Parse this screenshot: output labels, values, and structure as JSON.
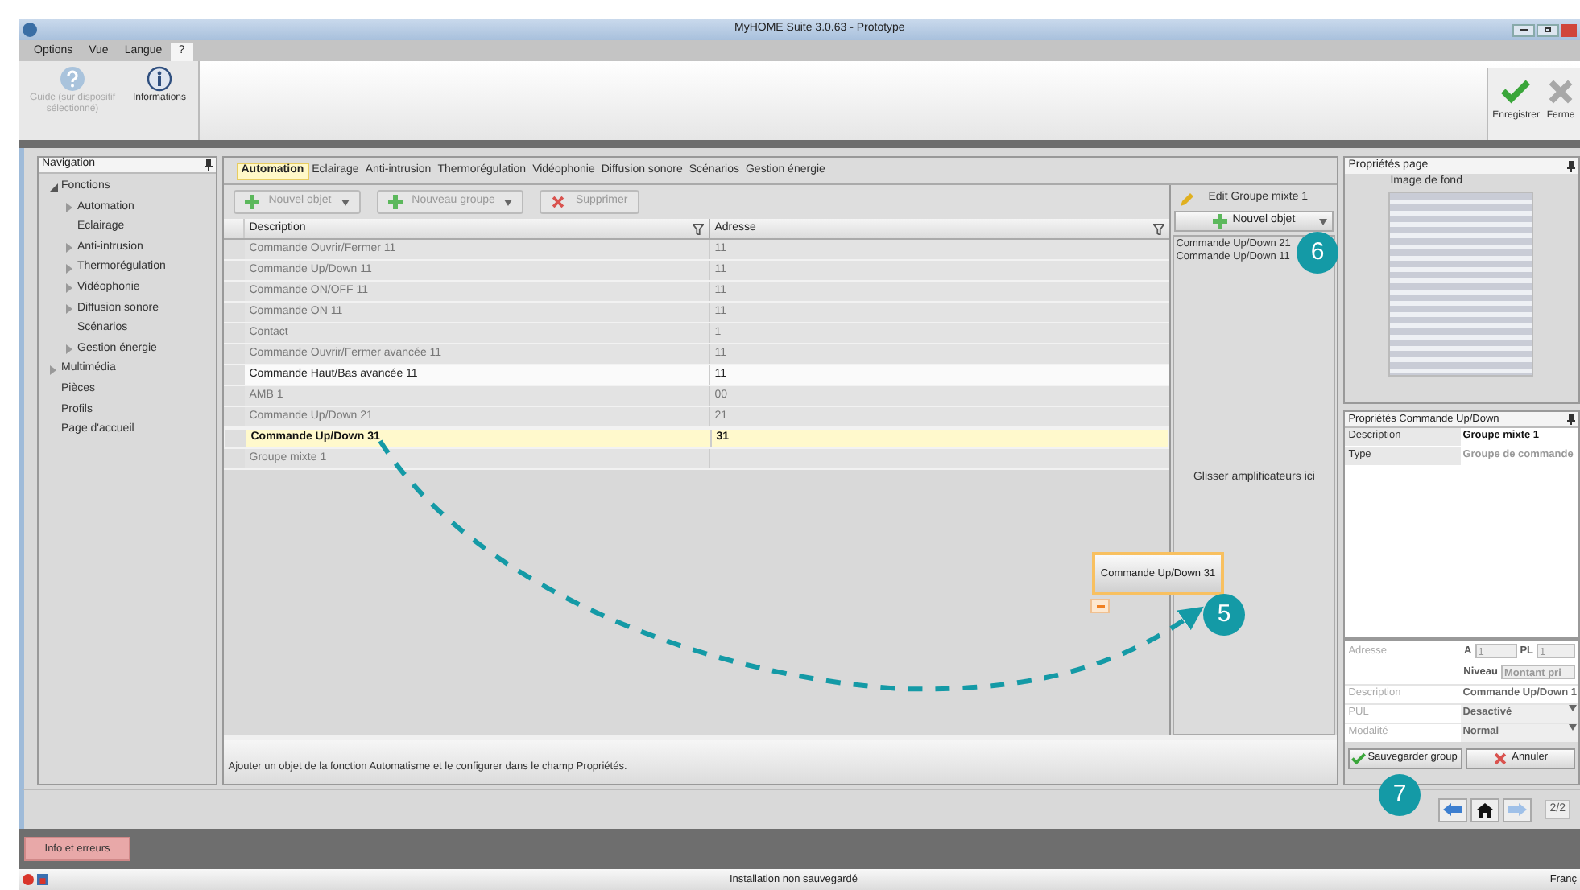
{
  "window": {
    "title": "MyHOME Suite 3.0.63 - Prototype"
  },
  "menu": [
    {
      "label": "Options",
      "selected": false
    },
    {
      "label": "Vue",
      "selected": false
    },
    {
      "label": "Langue",
      "selected": false
    },
    {
      "label": "?",
      "selected": true
    }
  ],
  "ribbon": {
    "left": [
      {
        "label": "Guide (sur dispositif sélectionné)",
        "disabled": true,
        "kind": "help"
      },
      {
        "label": "Informations",
        "disabled": false,
        "kind": "info"
      }
    ],
    "right": [
      {
        "label": "Enregistrer",
        "kind": "save"
      },
      {
        "label": "Ferme",
        "kind": "close"
      }
    ]
  },
  "navigation": {
    "title": "Navigation",
    "items": [
      {
        "label": "Fonctions",
        "kind": "group",
        "expanded": true,
        "children": [
          {
            "label": "Automation",
            "kind": "group",
            "expanded": false
          },
          {
            "label": "Eclairage",
            "kind": "leaf"
          },
          {
            "label": "Anti-intrusion",
            "kind": "group",
            "expanded": false
          },
          {
            "label": "Thermorégulation",
            "kind": "group",
            "expanded": false
          },
          {
            "label": "Vidéophonie",
            "kind": "group",
            "expanded": false
          },
          {
            "label": "Diffusion sonore",
            "kind": "group",
            "expanded": false
          },
          {
            "label": "Scénarios",
            "kind": "leaf"
          },
          {
            "label": "Gestion énergie",
            "kind": "group",
            "expanded": false
          }
        ]
      },
      {
        "label": "Multimédia",
        "kind": "group",
        "expanded": false
      },
      {
        "label": "Pièces",
        "kind": "leaf"
      },
      {
        "label": "Profils",
        "kind": "leaf"
      },
      {
        "label": "Page d'accueil",
        "kind": "leaf"
      }
    ]
  },
  "tabs": [
    {
      "label": "Automation",
      "selected": true
    },
    {
      "label": "Eclairage",
      "selected": false
    },
    {
      "label": "Anti-intrusion",
      "selected": false
    },
    {
      "label": "Thermorégulation",
      "selected": false
    },
    {
      "label": "Vidéophonie",
      "selected": false
    },
    {
      "label": "Diffusion sonore",
      "selected": false
    },
    {
      "label": "Scénarios",
      "selected": false
    },
    {
      "label": "Gestion énergie",
      "selected": false
    }
  ],
  "toolbar": [
    {
      "label": "Nouvel objet",
      "kind": "add",
      "dropdown": true
    },
    {
      "label": "Nouveau groupe",
      "kind": "add",
      "dropdown": true
    },
    {
      "label": "Supprimer",
      "kind": "delete",
      "dropdown": false
    }
  ],
  "table": {
    "columns": [
      "Description",
      "Adresse"
    ],
    "rows": [
      {
        "description": "Commande Ouvrir/Fermer 11",
        "address": "11",
        "selected": false,
        "hovered": false
      },
      {
        "description": "Commande Up/Down 11",
        "address": "11",
        "selected": false,
        "hovered": false
      },
      {
        "description": "Commande ON/OFF 11",
        "address": "11",
        "selected": false,
        "hovered": false
      },
      {
        "description": "Commande ON 11",
        "address": "11",
        "selected": false,
        "hovered": false
      },
      {
        "description": "Contact",
        "address": "1",
        "selected": false,
        "hovered": false
      },
      {
        "description": "Commande Ouvrir/Fermer avancée 11",
        "address": "11",
        "selected": false,
        "hovered": false
      },
      {
        "description": "Commande Haut/Bas avancée 11",
        "address": "11",
        "selected": false,
        "hovered": true
      },
      {
        "description": "AMB 1",
        "address": "00",
        "selected": false,
        "hovered": false
      },
      {
        "description": "Commande Up/Down 21",
        "address": "21",
        "selected": false,
        "hovered": false
      },
      {
        "description": "Commande Up/Down 31",
        "address": "31",
        "selected": true,
        "hovered": false
      },
      {
        "description": "Groupe mixte 1",
        "address": "",
        "selected": false,
        "hovered": false
      }
    ]
  },
  "edit_panel": {
    "title": "Edit Groupe mixte 1",
    "button": "Nouvel objet",
    "items": [
      "Commande Up/Down 21",
      "Commande Up/Down 11"
    ],
    "drop_hint": "Glisser amplificateurs ici"
  },
  "drag_item": "Commande Up/Down 31",
  "help_text": "Ajouter un objet de la fonction Automatisme et le configurer dans le champ Propriétés.",
  "page_properties": {
    "title": "Propriétés page",
    "image_label": "Image de fond"
  },
  "object_properties": {
    "title": "Propriétés Commande Up/Down",
    "rows": [
      {
        "label": "Description",
        "value": "Groupe mixte 1",
        "disabled": false
      },
      {
        "label": "Type",
        "value": "Groupe de commande",
        "disabled": true
      }
    ],
    "address_label": "Adresse",
    "a_label": "A",
    "a_value": "1",
    "pl_label": "PL",
    "pl_value": "1",
    "level_label": "Niveau",
    "level_value": "Montant pri",
    "fields": [
      {
        "label": "Description",
        "value": "Commande Up/Down 1",
        "dropdown": false
      },
      {
        "label": "PUL",
        "value": "Desactivé",
        "dropdown": true
      },
      {
        "label": "Modalité",
        "value": "Normal",
        "dropdown": true
      }
    ],
    "save_button": "Sauvegarder group",
    "cancel_button": "Annuler"
  },
  "page_nav": {
    "page": "2/2"
  },
  "callouts": [
    "5",
    "6",
    "7"
  ],
  "bottom_button": "Info et erreurs",
  "status_bar": {
    "message": "Installation non sauvegardé",
    "language": "Franç"
  }
}
